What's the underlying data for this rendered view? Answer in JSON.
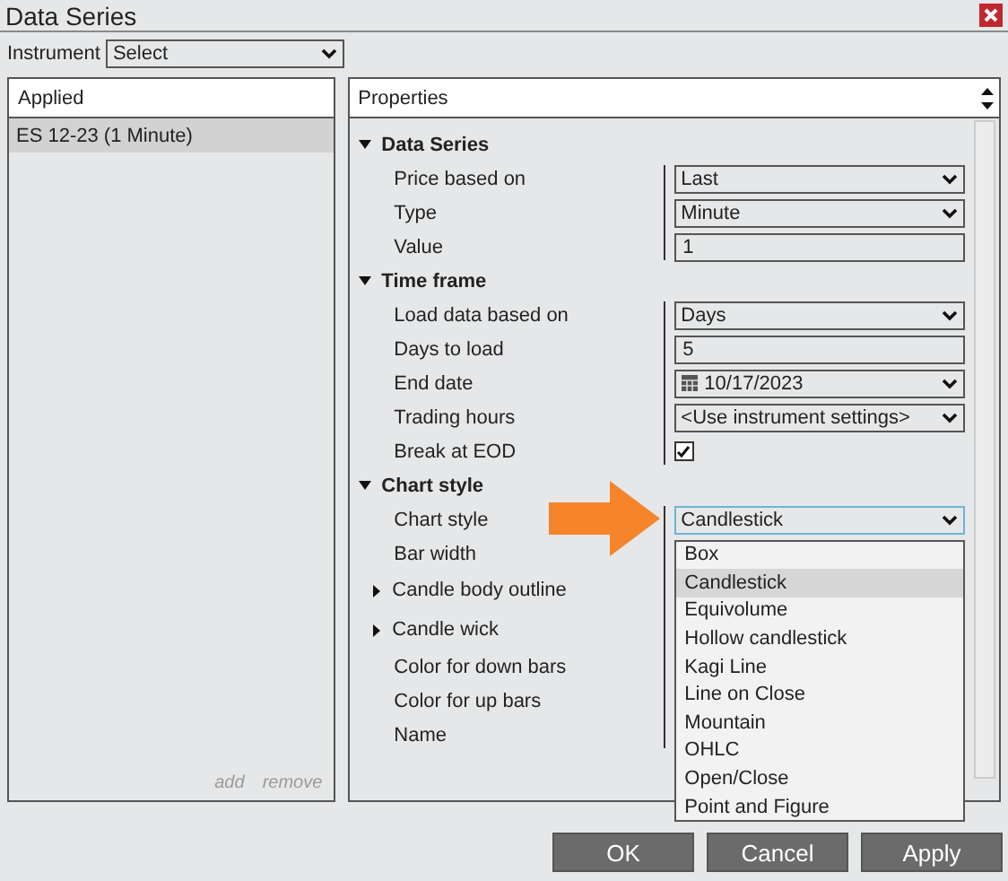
{
  "window": {
    "title": "Data Series"
  },
  "instrument": {
    "label": "Instrument",
    "value": "Select"
  },
  "applied": {
    "header": "Applied",
    "items": [
      {
        "label": "ES 12-23 (1 Minute)",
        "selected": true
      }
    ],
    "links": [
      "add",
      "remove"
    ]
  },
  "properties": {
    "header": "Properties",
    "categories": [
      {
        "title": "Data Series",
        "expanded": true,
        "rows": [
          {
            "label": "Price based on",
            "kind": "select",
            "value": "Last"
          },
          {
            "label": "Type",
            "kind": "select",
            "value": "Minute"
          },
          {
            "label": "Value",
            "kind": "text",
            "value": "1"
          }
        ]
      },
      {
        "title": "Time frame",
        "expanded": true,
        "rows": [
          {
            "label": "Load data based on",
            "kind": "select",
            "value": "Days"
          },
          {
            "label": "Days to load",
            "kind": "text",
            "value": "5"
          },
          {
            "label": "End date",
            "kind": "date",
            "value": "10/17/2023"
          },
          {
            "label": "Trading hours",
            "kind": "select",
            "value": "<Use instrument settings>"
          },
          {
            "label": "Break at EOD",
            "kind": "checkbox",
            "checked": true
          }
        ]
      },
      {
        "title": "Chart style",
        "expanded": true,
        "rows": [
          {
            "label": "Chart style",
            "kind": "open-select",
            "value": "Candlestick",
            "options": [
              {
                "label": "Box",
                "selected": false
              },
              {
                "label": "Candlestick",
                "selected": true
              },
              {
                "label": "Equivolume",
                "selected": false
              },
              {
                "label": "Hollow candlestick",
                "selected": false
              },
              {
                "label": "Kagi Line",
                "selected": false
              },
              {
                "label": "Line on Close",
                "selected": false
              },
              {
                "label": "Mountain",
                "selected": false
              },
              {
                "label": "OHLC",
                "selected": false
              },
              {
                "label": "Open/Close",
                "selected": false
              },
              {
                "label": "Point and Figure",
                "selected": false
              }
            ]
          },
          {
            "label": "Bar width",
            "kind": "hidden"
          },
          {
            "label": "Candle body outline",
            "kind": "group",
            "expanded": false
          },
          {
            "label": "Candle wick",
            "kind": "group",
            "expanded": false
          },
          {
            "label": "Color for down bars",
            "kind": "hidden"
          },
          {
            "label": "Color for up bars",
            "kind": "hidden"
          },
          {
            "label": "Name",
            "kind": "hidden"
          }
        ]
      }
    ]
  },
  "buttons": [
    "OK",
    "Cancel",
    "Apply"
  ]
}
